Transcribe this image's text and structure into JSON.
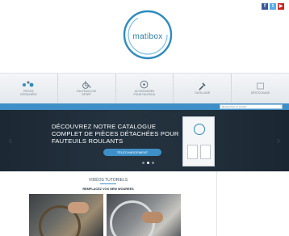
{
  "social": [
    {
      "icon": "facebook-icon",
      "glyph": "f"
    },
    {
      "icon": "twitter-icon",
      "glyph": "t"
    },
    {
      "icon": "youtube-icon",
      "glyph": "▶"
    }
  ],
  "logo": {
    "text": "matibox"
  },
  "nav": [
    {
      "icon": "parts-icon",
      "label": "PIÈCES\nDÉTACHÉES"
    },
    {
      "icon": "wheelchair-icon",
      "label": "FAUTEUILS DE\nSPORT"
    },
    {
      "icon": "accessories-icon",
      "label": "ACCESSOIRES\nPOUR FAUTEUIL"
    },
    {
      "icon": "tools-icon",
      "label": "OUTILLAGE"
    },
    {
      "icon": "sale-icon",
      "label": "DÉSTOCKAGE"
    }
  ],
  "search": {
    "placeholder": "Recherchez un produit"
  },
  "banner": {
    "title": "DÉCOUVREZ NOTRE CATALOGUE COMPLET DE PIÈCES DÉTACHÉES POUR FAUTEUILS ROULANTS",
    "button": "TÉLÉCHARGEMENT",
    "slides": 3,
    "active_slide": 2
  },
  "videos": {
    "title": "VIDÉOS TUTORIELS",
    "subtitle": "REMPLACEZ VOS NEW WOUREES"
  },
  "colors": {
    "accent": "#3e8fc7",
    "banner": "#1f2c38",
    "nav_text": "#6d7f8b"
  }
}
